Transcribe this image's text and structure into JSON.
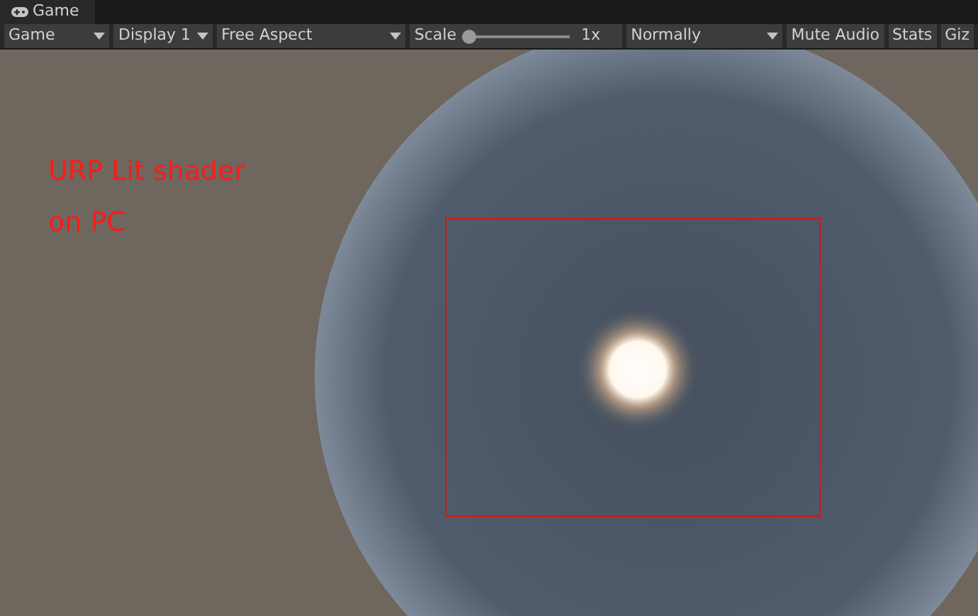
{
  "tab": {
    "title": "Game"
  },
  "toolbar": {
    "display_mode": "Game",
    "display": "Display 1",
    "aspect": "Free Aspect",
    "scale": {
      "label": "Scale",
      "level": 0,
      "reading": "1x"
    },
    "play_mode": "Normally",
    "buttons": [
      "Mute Audio",
      "Stats",
      "Giz"
    ]
  },
  "viewport": {
    "caption_lines": [
      "URP Lit shader",
      "on PC"
    ]
  }
}
